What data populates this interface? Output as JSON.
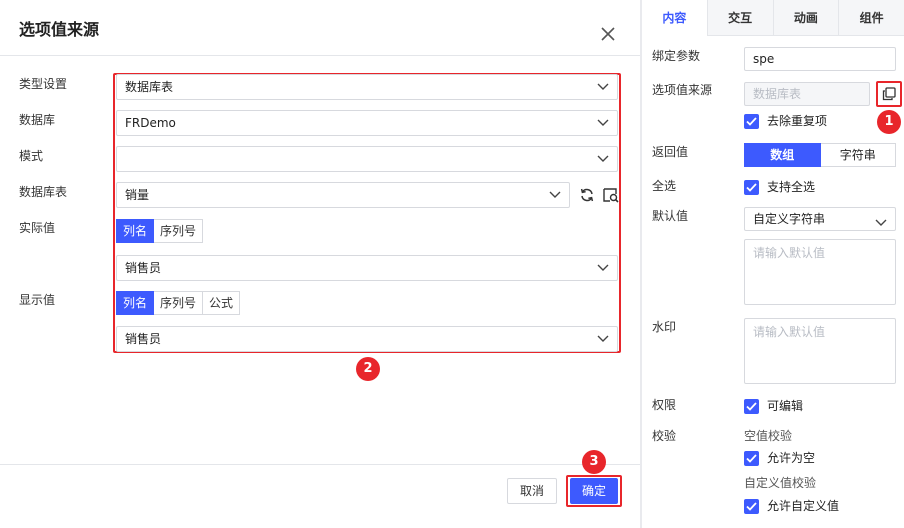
{
  "dialog": {
    "title": "选项值来源",
    "labels": {
      "type": "类型设置",
      "database": "数据库",
      "schema": "模式",
      "table": "数据库表",
      "actual": "实际值",
      "display": "显示值"
    },
    "type_value": "数据库表",
    "database_value": "FRDemo",
    "schema_value": "",
    "table_value": "销量",
    "actual_tabs": [
      "列名",
      "序列号"
    ],
    "actual_value": "销售员",
    "display_tabs": [
      "列名",
      "序列号",
      "公式"
    ],
    "display_value": "销售员",
    "cancel_label": "取消",
    "confirm_label": "确定",
    "badges": [
      "1",
      "2",
      "3"
    ]
  },
  "panel": {
    "tabs": [
      "内容",
      "交互",
      "动画",
      "组件"
    ],
    "bind_param_label": "绑定参数",
    "bind_param_value": "spe",
    "option_source_label": "选项值来源",
    "option_source_value": "数据库表",
    "dedupe_label": "去除重复项",
    "return_label": "返回值",
    "return_options": [
      "数组",
      "字符串"
    ],
    "select_all_label": "全选",
    "support_select_all": "支持全选",
    "default_label": "默认值",
    "default_type": "自定义字符串",
    "default_placeholder": "请输入默认值",
    "watermark_label": "水印",
    "watermark_placeholder": "请输入默认值",
    "permission_label": "权限",
    "editable_label": "可编辑",
    "validation_label": "校验",
    "empty_check_label": "空值校验",
    "allow_empty_label": "允许为空",
    "custom_check_label": "自定义值校验",
    "allow_custom_label": "允许自定义值"
  },
  "colors": {
    "accent": "#3d5afe",
    "highlight": "#e8262b"
  },
  "icons": [
    "close-icon",
    "chevron-down-icon",
    "refresh-icon",
    "preview-icon",
    "copy-icon",
    "checkmark-icon"
  ]
}
